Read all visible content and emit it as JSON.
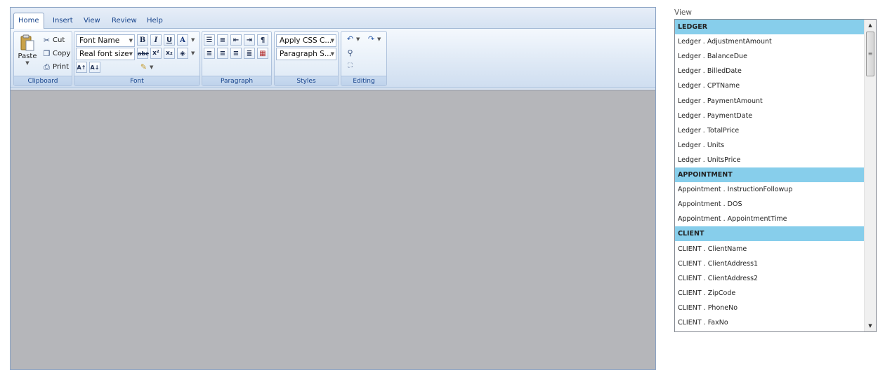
{
  "tabs": [
    "Home",
    "Insert",
    "View",
    "Review",
    "Help"
  ],
  "clipboard": {
    "paste": "Paste",
    "cut": "Cut",
    "copy": "Copy",
    "print": "Print",
    "label": "Clipboard"
  },
  "font": {
    "font_name": "Font Name",
    "font_size": "Real font size",
    "label": "Font",
    "bold": "B",
    "italic": "I",
    "underline": "U",
    "color": "A"
  },
  "paragraph": {
    "label": "Paragraph"
  },
  "styles": {
    "css": "Apply CSS C...",
    "para": "Paragraph S...",
    "label": "Styles"
  },
  "editing": {
    "label": "Editing"
  },
  "view": {
    "title": "View",
    "rows": [
      {
        "text": "LEDGER",
        "head": true
      },
      {
        "text": "Ledger . AdjustmentAmount"
      },
      {
        "text": "Ledger . BalanceDue"
      },
      {
        "text": "Ledger . BilledDate"
      },
      {
        "text": "Ledger . CPTName"
      },
      {
        "text": "Ledger . PaymentAmount"
      },
      {
        "text": "Ledger . PaymentDate"
      },
      {
        "text": "Ledger . TotalPrice"
      },
      {
        "text": "Ledger . Units"
      },
      {
        "text": "Ledger . UnitsPrice"
      },
      {
        "text": "APPOINTMENT",
        "head": true
      },
      {
        "text": "Appointment . InstructionFollowup"
      },
      {
        "text": "Appointment . DOS"
      },
      {
        "text": "Appointment . AppointmentTime"
      },
      {
        "text": "CLIENT",
        "head": true
      },
      {
        "text": "CLIENT . ClientName"
      },
      {
        "text": "CLIENT . ClientAddress1"
      },
      {
        "text": "CLIENT . ClientAddress2"
      },
      {
        "text": "CLIENT . ZipCode"
      },
      {
        "text": "CLIENT . PhoneNo"
      },
      {
        "text": "CLIENT . FaxNo"
      }
    ]
  },
  "colors": {
    "header_row": "#87ceeb",
    "document_bg": "#b5b6ba"
  }
}
